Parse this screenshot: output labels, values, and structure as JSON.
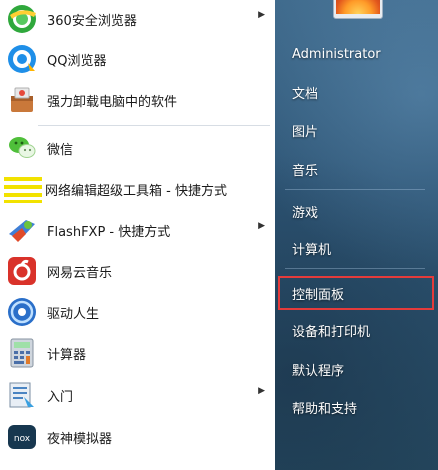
{
  "programs": [
    {
      "label": "360安全浏览器",
      "has_submenu": true,
      "icon": "360-browser-icon"
    },
    {
      "label": "QQ浏览器",
      "has_submenu": false,
      "icon": "qq-browser-icon"
    },
    {
      "label": "强力卸载电脑中的软件",
      "has_submenu": false,
      "icon": "uninstaller-icon"
    },
    {
      "label": "微信",
      "has_submenu": false,
      "icon": "wechat-icon"
    },
    {
      "label": "网络编辑超级工具箱 - 快捷方式",
      "has_submenu": false,
      "icon": "toolbox-icon"
    },
    {
      "label": "FlashFXP - 快捷方式",
      "has_submenu": true,
      "icon": "flashfxp-icon"
    },
    {
      "label": "网易云音乐",
      "has_submenu": false,
      "icon": "netease-music-icon"
    },
    {
      "label": "驱动人生",
      "has_submenu": false,
      "icon": "driver-life-icon"
    },
    {
      "label": "计算器",
      "has_submenu": false,
      "icon": "calculator-icon"
    },
    {
      "label": "入门",
      "has_submenu": true,
      "icon": "getting-started-icon"
    },
    {
      "label": "夜神模拟器",
      "has_submenu": false,
      "icon": "nox-emulator-icon"
    }
  ],
  "right_panel": {
    "items": [
      {
        "label": "Administrator"
      },
      {
        "label": "文档"
      },
      {
        "label": "图片"
      },
      {
        "label": "音乐"
      },
      {
        "label": "游戏"
      },
      {
        "label": "计算机"
      },
      {
        "label": "控制面板",
        "highlighted": true
      },
      {
        "label": "设备和打印机"
      },
      {
        "label": "默认程序"
      },
      {
        "label": "帮助和支持"
      }
    ],
    "highlight_color": "#e43b3b"
  },
  "icon_text": {
    "nox": "nox"
  }
}
